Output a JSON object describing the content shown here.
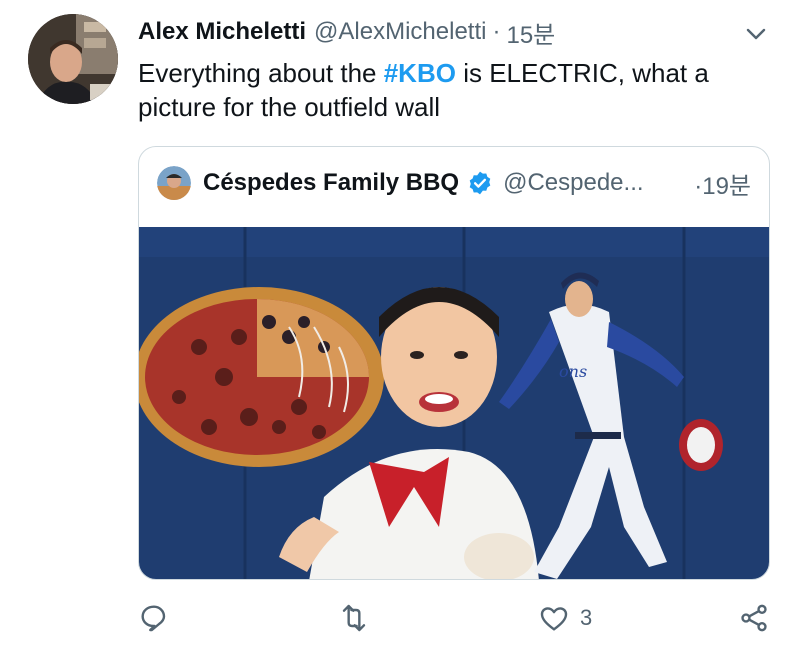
{
  "tweet": {
    "author_name": "Alex Micheletti",
    "author_handle": "@AlexMicheletti",
    "separator": "·",
    "time": "15분",
    "text_before": "Everything about the ",
    "hashtag": "#KBO",
    "text_after": " is ELECTRIC, what a picture for the outfield wall"
  },
  "quoted_tweet": {
    "author_name": "Céspedes Family BBQ",
    "author_handle": "@Cespede...",
    "separator": "·",
    "time": "19분"
  },
  "actions": {
    "reply_count": "",
    "retweet_count": "",
    "like_count": "3"
  },
  "colors": {
    "accent": "#1d9bf0",
    "secondary_text": "#536471",
    "border": "#cfd9de"
  },
  "icons": [
    "chevron-down-icon",
    "verified-badge-icon",
    "reply-icon",
    "retweet-icon",
    "like-icon",
    "share-icon"
  ]
}
